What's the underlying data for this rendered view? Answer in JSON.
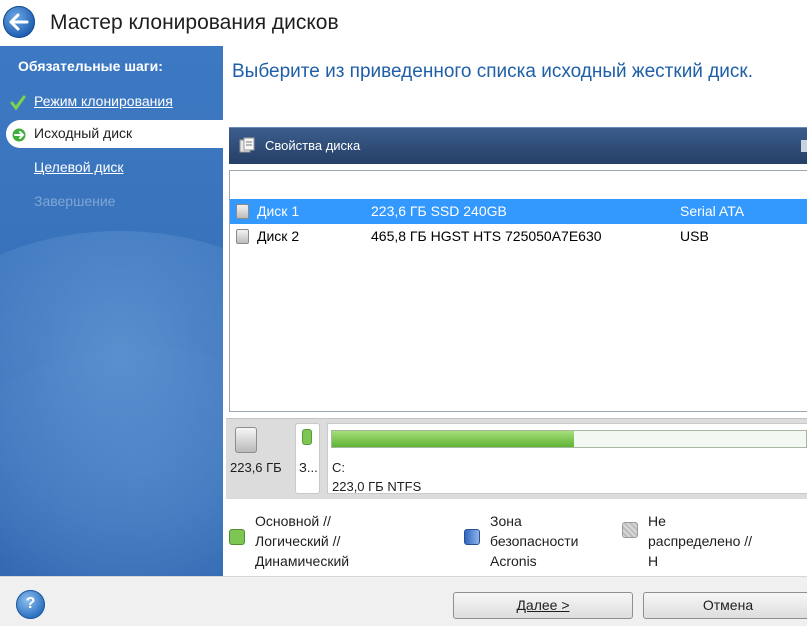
{
  "window": {
    "title": "Мастер клонирования дисков"
  },
  "sidebar": {
    "heading": "Обязательные шаги:",
    "steps": [
      {
        "label": "Режим клонирования",
        "state": "done"
      },
      {
        "label": "Исходный диск",
        "state": "current"
      },
      {
        "label": "Целевой диск",
        "state": "next"
      },
      {
        "label": "Завершение",
        "state": "disabled"
      }
    ]
  },
  "main": {
    "heading": "Выберите из приведенного списка исходный жесткий диск.",
    "toolbar": {
      "properties_label": "Свойства диска"
    },
    "disks": [
      {
        "name": "Диск 1",
        "details": "223,6 ГБ SSD 240GB",
        "interface": "Serial ATA",
        "selected": true
      },
      {
        "name": "Диск 2",
        "details": "465,8 ГБ HGST HTS 725050A7E630",
        "interface": "USB",
        "selected": false
      }
    ],
    "disk_map": {
      "disk_size": "223,6 ГБ",
      "small_partition_label": "З...",
      "partition_label": "C:",
      "partition_details": "223,0 ГБ  NTFS",
      "used_fraction": 0.51
    },
    "legend": [
      {
        "label": "Основной //\nЛогический //\nДинамический",
        "color": "#7ec653"
      },
      {
        "label": "Зона\nбезопасности\nAcronis",
        "color": "#2f66c4"
      },
      {
        "label": "Не распределено // Н\nподдерживается",
        "color": "#cccccc"
      }
    ]
  },
  "footer": {
    "help_label": "?",
    "next_label": "Далее >",
    "cancel_label": "Отмена"
  },
  "colors": {
    "accent": "#3399ff",
    "sidebar": "#3a74bd",
    "heading": "#1e5fa8"
  }
}
